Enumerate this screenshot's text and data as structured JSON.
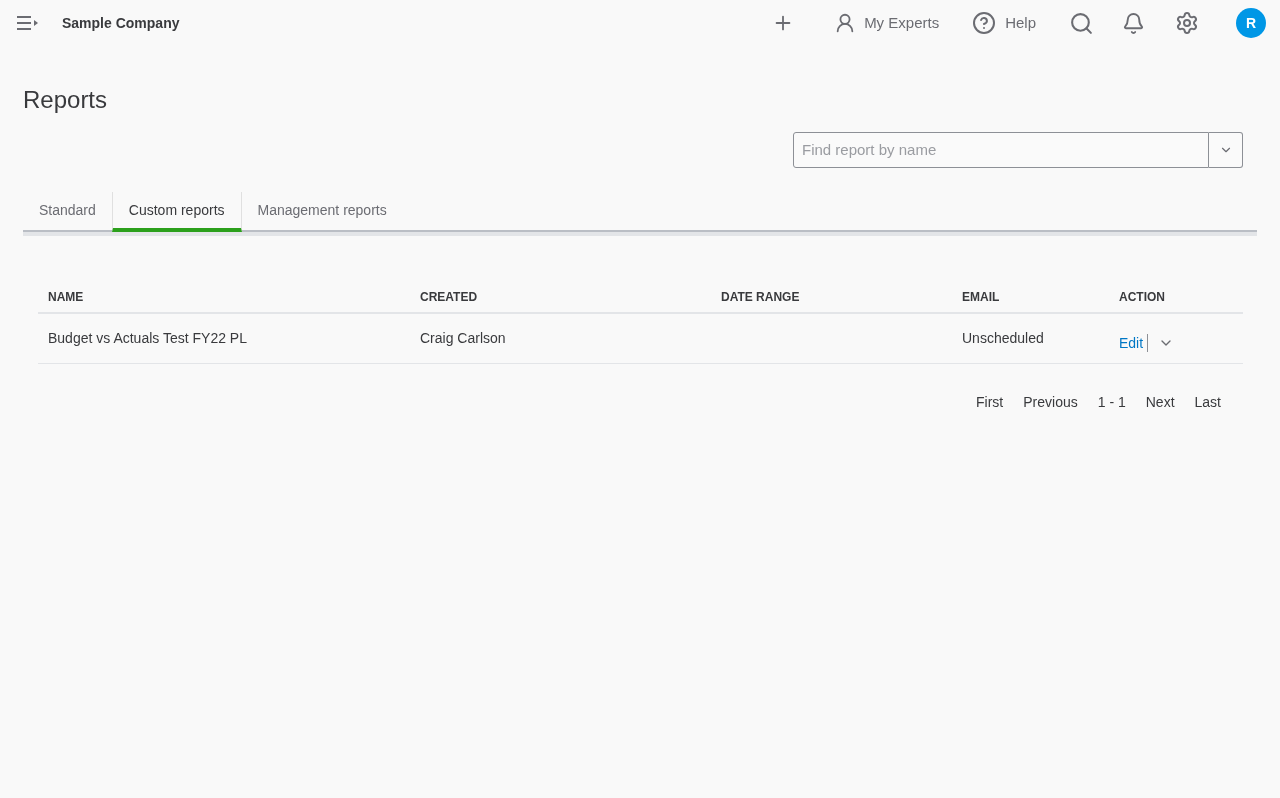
{
  "header": {
    "company": "Sample Company",
    "experts": "My Experts",
    "help": "Help",
    "avatar": "R"
  },
  "page_title": "Reports",
  "search": {
    "placeholder": "Find report by name"
  },
  "tabs": [
    {
      "label": "Standard",
      "selected": false
    },
    {
      "label": "Custom reports",
      "selected": true
    },
    {
      "label": "Management reports",
      "selected": false
    }
  ],
  "table": {
    "columns": [
      "NAME",
      "CREATED",
      "DATE RANGE",
      "EMAIL",
      "ACTION"
    ],
    "rows": [
      {
        "name": "Budget vs Actuals Test FY22 PL",
        "created": "Craig Carlson",
        "email": "Unscheduled",
        "action": "Edit"
      }
    ]
  },
  "pagination": [
    "First",
    "Previous",
    "1 - 1",
    "Next",
    "Last"
  ]
}
